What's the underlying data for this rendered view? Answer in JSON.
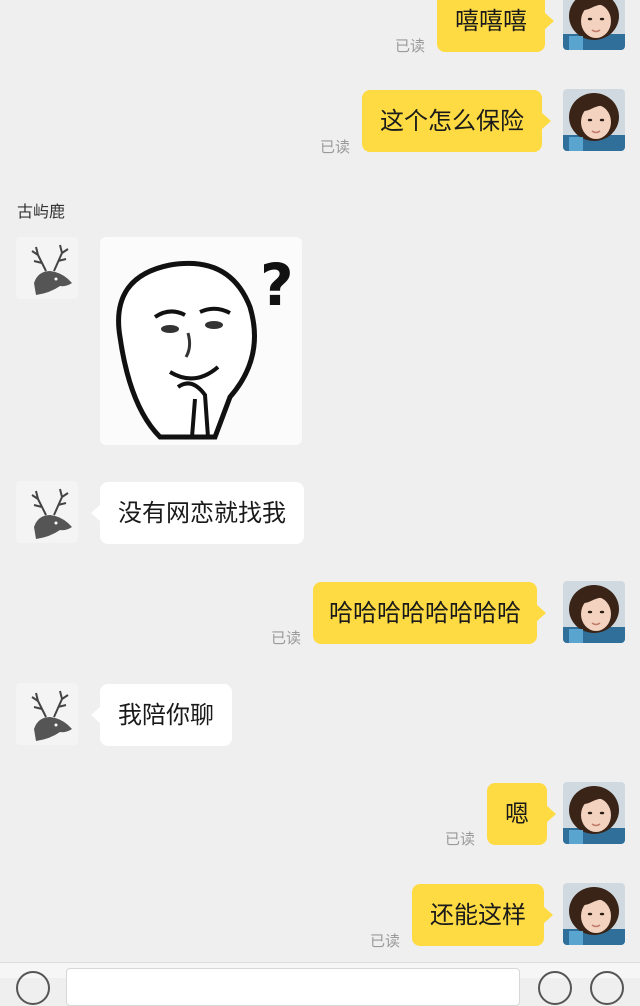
{
  "read_label": "已读",
  "sender_name": "古屿鹿",
  "messages": [
    {
      "text": "嘻嘻嘻"
    },
    {
      "text": "这个怎么保险"
    },
    {
      "text": "没有网恋就找我"
    },
    {
      "text": "哈哈哈哈哈哈哈哈"
    },
    {
      "text": "我陪你聊"
    },
    {
      "text": "嗯"
    },
    {
      "text": "还能这样"
    }
  ],
  "sticker": {
    "symbol": "?"
  },
  "colors": {
    "my_bubble": "#fedb43",
    "their_bubble": "#ffffff",
    "background": "#efeff0"
  }
}
